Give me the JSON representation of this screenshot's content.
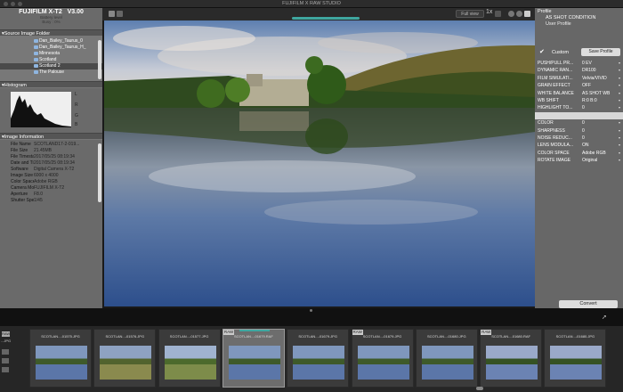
{
  "window": {
    "title": "FUJIFILM X RAW STUDIO"
  },
  "progress": 1.0,
  "camera": {
    "model": "FUJIFILM X-T2",
    "version": "V3.00",
    "battery": "Battery level",
    "busy": "Busy : 0%"
  },
  "left_sections": {
    "folder": "Source Image Folder",
    "histogram": "Histogram",
    "info": "Image Information"
  },
  "folders": [
    {
      "label": "Dan_Bailey_Taurus_0"
    },
    {
      "label": "Dan_Bailey_Taurus_H_"
    },
    {
      "label": "Minnesota"
    },
    {
      "label": "Scotland"
    },
    {
      "label": "Scotland 2"
    },
    {
      "label": "The Palouse"
    }
  ],
  "histogram": {
    "labels": [
      "L",
      "R",
      "G",
      "B"
    ]
  },
  "info_rows": [
    {
      "key": "File Name",
      "value": "SCOTLAND17-2-019..."
    },
    {
      "key": "File Size",
      "value": "21.45MB"
    },
    {
      "key": "File Timesta...",
      "value": "2017/05/25 08:19:34"
    },
    {
      "key": "Date and Ti...",
      "value": "2017/05/25 08:19:34"
    },
    {
      "key": "Software",
      "value": "Digital Camera X-T2"
    },
    {
      "key": "Image Size",
      "value": "6000 x 4000"
    },
    {
      "key": "Color Space",
      "value": "Adobe RGB"
    },
    {
      "key": "Camera Model",
      "value": "FUJIFILM X-T2"
    },
    {
      "key": "Aperture",
      "value": "F8.0"
    },
    {
      "key": "Shutter Speed",
      "value": "1/45"
    }
  ],
  "toolbar": {
    "full_view": "Full view",
    "zoom_label": "1x"
  },
  "right": {
    "header": "Profile",
    "profiles": [
      "AS SHOT CONDITION",
      "User Profile"
    ],
    "custom_label": "Custom",
    "save_label": "Save Profile",
    "convert_label": "Convert",
    "params": [
      {
        "key": "PUSH/PULL PR...",
        "value": "0 EV"
      },
      {
        "key": "DYNAMIC RAN...",
        "value": "DR100"
      },
      {
        "key": "FILM SIMULATI...",
        "value": "Velvia/VIVID"
      },
      {
        "key": "GRAIN EFFECT",
        "value": "OFF"
      },
      {
        "key": "WHITE BALANCE",
        "value": "AS SHOT WB"
      },
      {
        "key": "WB SHIFT",
        "value": "R:0 B:0"
      },
      {
        "key": "HIGHLIGHT TO...",
        "value": "0"
      },
      {
        "key": "",
        "value": ""
      },
      {
        "key": "COLOR",
        "value": "0"
      },
      {
        "key": "SHARPNESS",
        "value": "0"
      },
      {
        "key": "NOISE REDUC...",
        "value": "0"
      },
      {
        "key": "LENS MODULA...",
        "value": "ON"
      },
      {
        "key": "COLOR SPACE",
        "value": "Adobe RGB"
      },
      {
        "key": "ROTATE IMAGE",
        "value": "Original"
      }
    ]
  },
  "filmstrip": [
    {
      "name": "SCOTLAN...-01575.JPG",
      "raw": "",
      "scene": "lake"
    },
    {
      "name": "SCOTLAN...-01576.JPG",
      "raw": "",
      "scene": "field"
    },
    {
      "name": "SCOTLAN...-01577.JPG",
      "raw": "",
      "scene": "field2"
    },
    {
      "name": "SCOTLAN...-01679.RAF",
      "raw": "RAW",
      "scene": "lake"
    },
    {
      "name": "SCOTLAN...-01679.JPG",
      "raw": "",
      "scene": "lake"
    },
    {
      "name": "SCOTLAN...-01679.JPG",
      "raw": "RAW",
      "scene": "lake"
    },
    {
      "name": "SCOTLAN...-01680.JPG",
      "raw": "",
      "scene": "lake"
    },
    {
      "name": "SCOTLAN...-01680.RAF",
      "raw": "RAW",
      "scene": "lake2"
    },
    {
      "name": "SCOTLAN...-01680.JPG",
      "raw": "",
      "scene": "lake2"
    }
  ],
  "filmstrip_left_raw": "RAW",
  "filmstrip_left_label": "...JPG"
}
